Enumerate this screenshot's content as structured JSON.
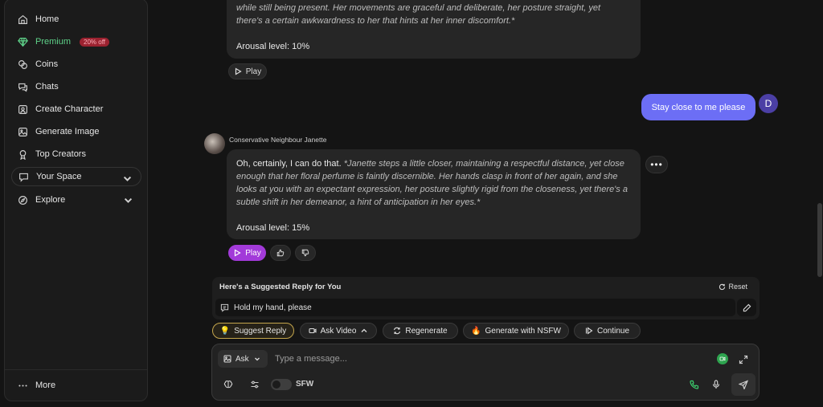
{
  "sidebar": {
    "items": [
      {
        "label": "Home",
        "icon": "home-icon"
      },
      {
        "label": "Premium",
        "icon": "diamond-icon",
        "badge": "20% off"
      },
      {
        "label": "Coins",
        "icon": "coins-icon"
      },
      {
        "label": "Chats",
        "icon": "chat-icon"
      },
      {
        "label": "Create Character",
        "icon": "create-character-icon"
      },
      {
        "label": "Generate Image",
        "icon": "image-icon"
      },
      {
        "label": "Top Creators",
        "icon": "trophy-icon"
      },
      {
        "label": "Your Space",
        "icon": "chat-bubble-icon"
      },
      {
        "label": "Explore",
        "icon": "compass-icon"
      }
    ],
    "more_label": "More"
  },
  "conversation": {
    "prev_message": {
      "line1": "while still being present. Her movements are graceful and deliberate, her posture straight, yet",
      "line2": "there's a certain awkwardness to her that hints at her inner discomfort.*",
      "arousal": "Arousal level: 10%",
      "play_label": "Play"
    },
    "user_message": {
      "text": "Stay close to me please",
      "avatar_letter": "D"
    },
    "character_name": "Conservative Neighbour Janette",
    "reply": {
      "lead": "Oh, certainly, I can do that.",
      "narration": "*Janette steps a little closer, maintaining a respectful distance, yet close enough that her floral perfume is faintly discernible. Her hands clasp in front of her again, and she looks at you with an expectant expression, her posture slightly rigid from the closeness, yet there's a subtle shift in her demeanor, a hint of anticipation in her eyes.*",
      "arousal": "Arousal level: 15%",
      "play_label": "Play"
    }
  },
  "suggested": {
    "title": "Here's a Suggested Reply for You",
    "reset_label": "Reset",
    "reply_text": "Hold my hand, please"
  },
  "actions": {
    "suggest_reply": "Suggest Reply",
    "ask_video": "Ask Video",
    "regenerate": "Regenerate",
    "generate_nsfw": "Generate with NSFW",
    "continue": "Continue"
  },
  "composer": {
    "ask_label": "Ask",
    "placeholder": "Type a message...",
    "sfw_label": "SFW"
  },
  "colors": {
    "premium": "#5fd38a",
    "user_bubble": "#6c6ef5",
    "play_active": "#a23ad9",
    "badge": "#9b2230"
  }
}
